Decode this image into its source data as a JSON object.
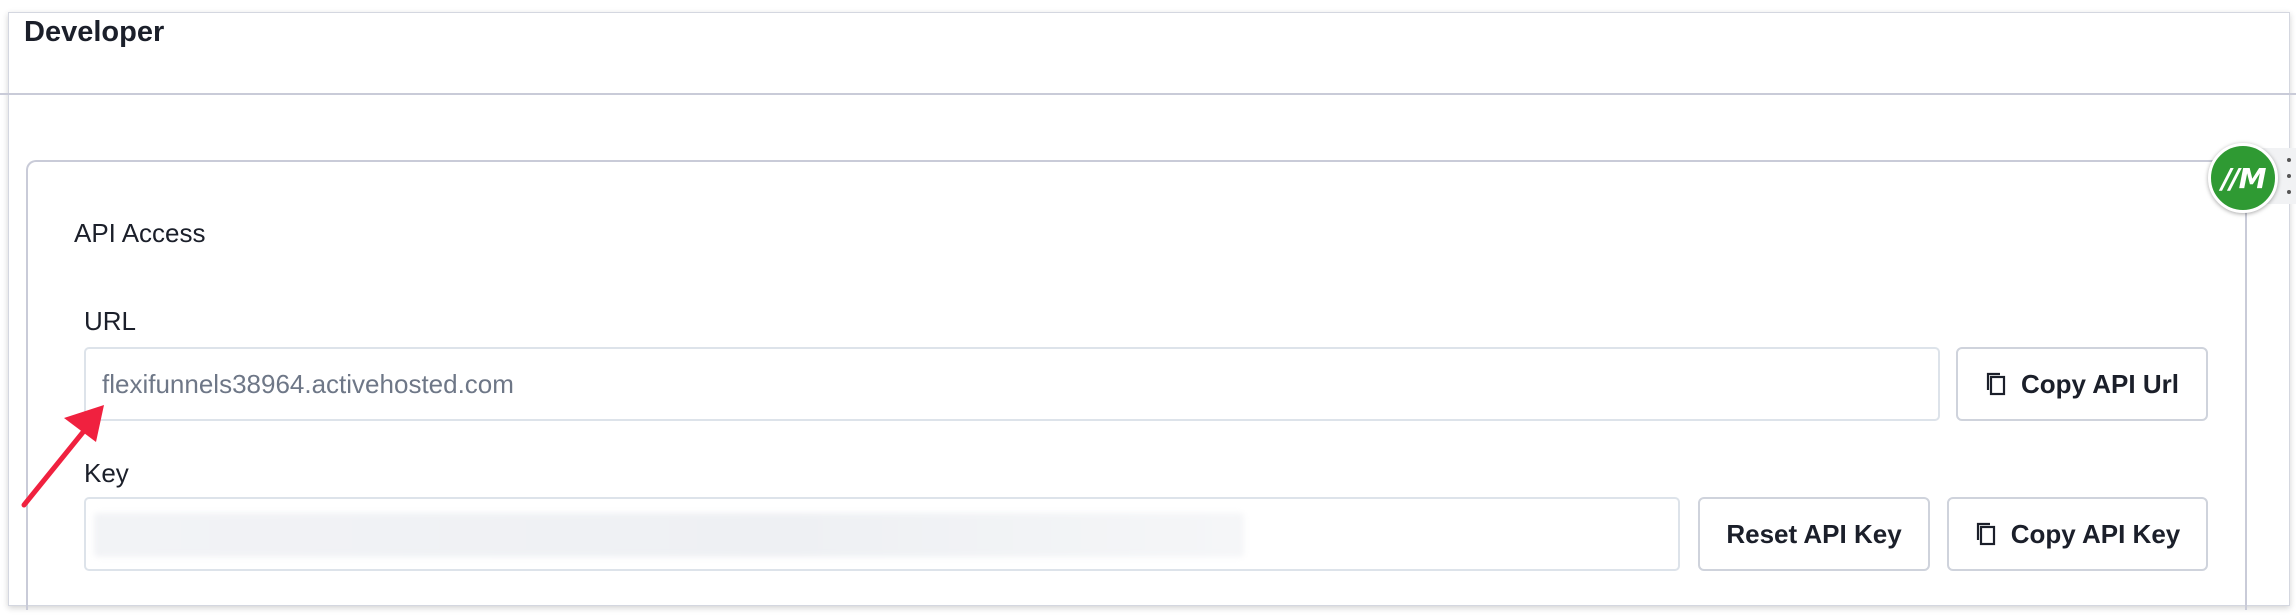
{
  "page": {
    "title": "Developer"
  },
  "api_access": {
    "section_title": "API Access",
    "url": {
      "label": "URL",
      "value": "flexifunnels38964.activehosted.com",
      "copy_button_label": "Copy API Url"
    },
    "key": {
      "label": "Key",
      "value": "",
      "reset_button_label": "Reset API Key",
      "copy_button_label": "Copy API Key"
    }
  },
  "overlay": {
    "badge_text": "// M"
  },
  "icons": {
    "copy": "copy-icon",
    "arrow": "annotation-arrow",
    "more": "more-vertical-icon"
  },
  "colors": {
    "arrow": "#f0213f",
    "badge": "#2f9a33",
    "text": "#1b1f2a",
    "muted_text": "#6e7787"
  }
}
